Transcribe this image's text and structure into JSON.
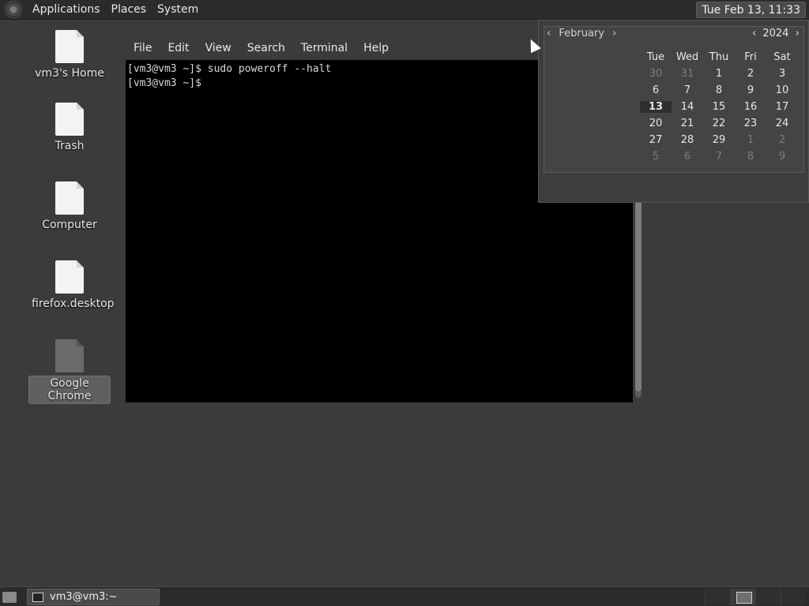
{
  "top_panel": {
    "menus": [
      "Applications",
      "Places",
      "System"
    ],
    "clock": "Tue Feb 13, 11:33"
  },
  "desktop": {
    "icons": [
      {
        "label": "vm3's Home"
      },
      {
        "label": "Trash"
      },
      {
        "label": "Computer"
      },
      {
        "label": "firefox.desktop"
      },
      {
        "label": "Google Chrome"
      }
    ]
  },
  "terminal": {
    "menus": [
      "File",
      "Edit",
      "View",
      "Search",
      "Terminal",
      "Help"
    ],
    "lines": [
      "[vm3@vm3 ~]$ sudo poweroff --halt",
      "[vm3@vm3 ~]$"
    ]
  },
  "calendar": {
    "month_label": "February",
    "year_label": "2024",
    "weekday_headers": [
      "Tue",
      "Wed",
      "Thu",
      "Fri",
      "Sat"
    ],
    "rows": [
      [
        "30",
        "31",
        "1",
        "2",
        "3"
      ],
      [
        "6",
        "7",
        "8",
        "9",
        "10"
      ],
      [
        "13",
        "14",
        "15",
        "16",
        "17"
      ],
      [
        "20",
        "21",
        "22",
        "23",
        "24"
      ],
      [
        "27",
        "28",
        "29",
        "1",
        "2"
      ],
      [
        "5",
        "6",
        "7",
        "8",
        "9"
      ]
    ],
    "today": "13"
  },
  "bottom_panel": {
    "task_label": "vm3@vm3:~"
  }
}
